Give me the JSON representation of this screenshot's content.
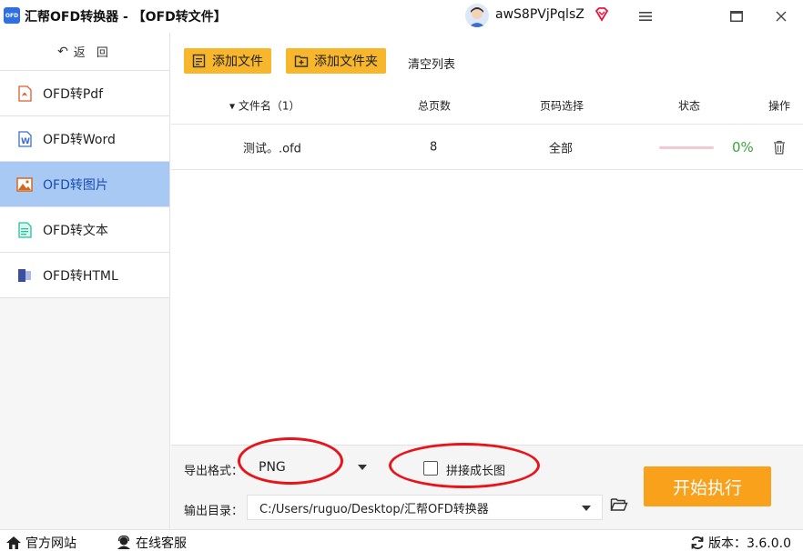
{
  "app": {
    "logo_text": "OFD",
    "title": "汇帮OFD转换器 - 【OFD转文件】"
  },
  "user": {
    "name": "awS8PVjPqlsZ"
  },
  "window_controls": {
    "menu_icon": "≡",
    "max_icon": "▭",
    "close_icon": "✕"
  },
  "sidebar": {
    "back": {
      "arrow": "↶",
      "label": "返 回"
    },
    "items": [
      {
        "label": "OFD转Pdf",
        "icon": "pdf-icon"
      },
      {
        "label": "OFD转Word",
        "icon": "word-icon"
      },
      {
        "label": "OFD转图片",
        "icon": "image-icon"
      },
      {
        "label": "OFD转文本",
        "icon": "text-icon"
      },
      {
        "label": "OFD转HTML",
        "icon": "html-icon"
      }
    ]
  },
  "toolbar": {
    "add_file": "添加文件",
    "add_folder": "添加文件夹",
    "clear_list": "清空列表"
  },
  "table": {
    "headers": {
      "name": "▾ 文件名（1）",
      "pages": "总页数",
      "page_select": "页码选择",
      "status": "状态",
      "action": "操作"
    },
    "rows": [
      {
        "name": "测试。.ofd",
        "pages": "8",
        "page_select": "全部",
        "progress": 0,
        "percent": "0%"
      }
    ]
  },
  "bottom": {
    "format_label": "导出格式：",
    "format_value": "PNG",
    "merge_label": "拼接成长图",
    "merge_checked": false,
    "output_label": "输出目录：",
    "output_path": "C:/Users/ruguo/Desktop/汇帮OFD转换器",
    "start_button": "开始执行"
  },
  "statusbar": {
    "website": "官方网站",
    "support": "在线客服",
    "version": "版本：3.6.0.0"
  },
  "colors": {
    "accent": "#f7b62b",
    "start_button": "#f9a11b",
    "active_nav": "#a9c9f5",
    "annotation": "#e8141b",
    "progress_text": "#3aa63a"
  }
}
